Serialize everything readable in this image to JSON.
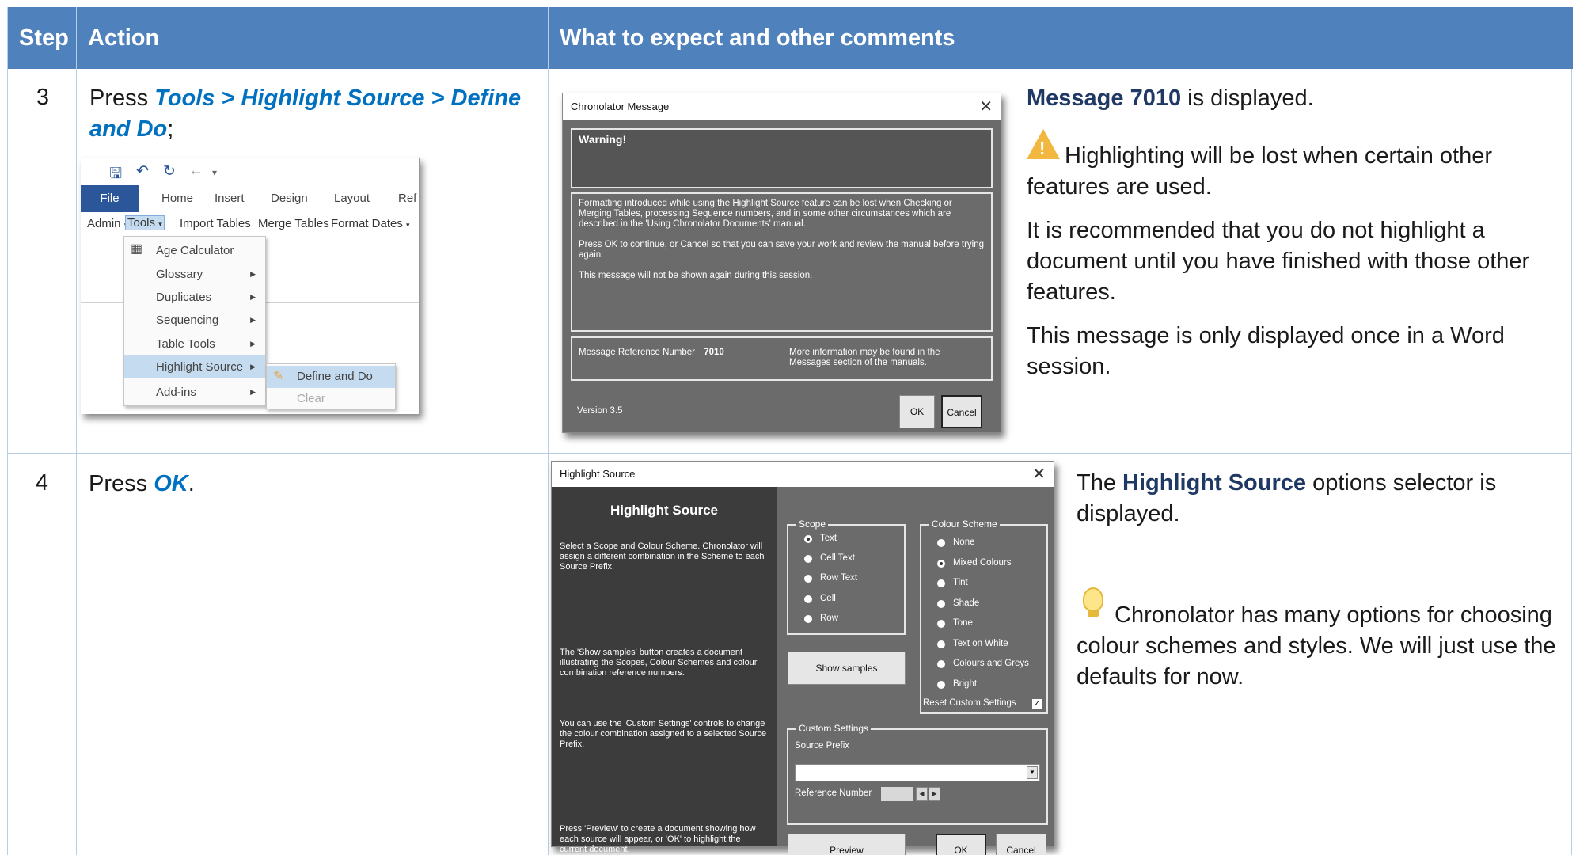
{
  "header": {
    "step": "Step",
    "action": "Action",
    "comments": "What to expect and other comments"
  },
  "row3": {
    "step": "3",
    "action_prefix": "Press ",
    "action_path": "Tools > Highlight Source > Define and Do",
    "action_suffix": ";",
    "ribbon": {
      "tabs": [
        "File",
        "Home",
        "Insert",
        "Design",
        "Layout",
        "Ref"
      ],
      "toolbar": [
        "Admin",
        "Tools",
        "Import Tables",
        "Merge Tables",
        "Format Dates"
      ],
      "menu": [
        "Age Calculator",
        "Glossary",
        "Duplicates",
        "Sequencing",
        "Table Tools",
        "Highlight Source",
        "Add-ins"
      ],
      "submenu": [
        "Define and Do",
        "Clear"
      ]
    },
    "dialog": {
      "title": "Chronolator Message",
      "warning": "Warning!",
      "body1": "Formatting introduced while using the Highlight Source feature can be lost when Checking or Merging Tables, processing Sequence numbers, and in some other circumstances which are described in the 'Using Chronolator Documents' manual.",
      "body2": "Press OK to continue, or Cancel so that you can save your work and review the manual before trying again.",
      "body3": "This message will not be shown again during this session.",
      "ref_label": "Message Reference Number",
      "ref_number": "7010",
      "more_info": "More information may be found in the Messages section of the manuals.",
      "version": "Version 3.5",
      "ok": "OK",
      "cancel": "Cancel"
    },
    "comment_title": "Message 7010",
    "comment_title_suffix": " is displayed.",
    "comment_warning": "Highlighting will be lost when certain other features are used.",
    "comment_p2": "It is recommended that you do not highlight a document until you have finished with those other features.",
    "comment_p3": "This message is only displayed once in a Word session."
  },
  "row4": {
    "step": "4",
    "action_prefix": "Press ",
    "action_ok": "OK",
    "action_suffix": ".",
    "dialog": {
      "title": "Highlight Source",
      "heading": "Highlight Source",
      "p1": "Select a Scope and Colour Scheme. Chronolator will assign a different combination in the Scheme to each Source Prefix.",
      "p2": "The 'Show samples' button creates a document illustrating the Scopes, Colour Schemes and colour combination reference numbers.",
      "p3": "You can use the 'Custom Settings' controls to change the colour combination assigned to a selected Source Prefix.",
      "p4": "Press 'Preview' to create a document showing how each source will appear, or 'OK' to highlight the current document.",
      "scope_label": "Scope",
      "scope_options": [
        "Text",
        "Cell Text",
        "Row Text",
        "Cell",
        "Row"
      ],
      "scheme_label": "Colour Scheme",
      "scheme_options": [
        "None",
        "Mixed Colours",
        "Tint",
        "Shade",
        "Tone",
        "Text on White",
        "Colours and Greys",
        "Bright"
      ],
      "reset_label": "Reset Custom Settings",
      "show_samples": "Show samples",
      "custom_label": "Custom Settings",
      "source_prefix": "Source Prefix",
      "reference_number": "Reference Number",
      "preview": "Preview",
      "ok": "OK",
      "cancel": "Cancel"
    },
    "comment_title_prefix": "The ",
    "comment_title": "Highlight Source",
    "comment_title_suffix": " options selector is displayed.",
    "comment_tip": "Chronolator has many options for choosing colour schemes and styles. We will just use the defaults for now."
  }
}
